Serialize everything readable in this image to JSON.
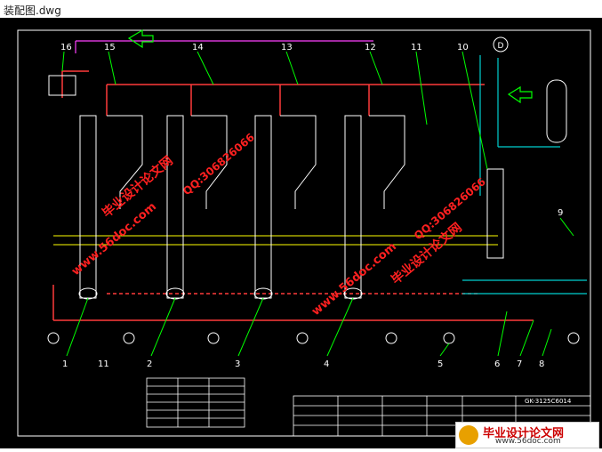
{
  "window": {
    "title": "装配图.dwg"
  },
  "colors": {
    "background": "#000000",
    "border": "#ffffff",
    "steam": "#ff3b3b",
    "water": "#00d0d0",
    "vacuum": "#ffff00",
    "condensate": "#ff40ff",
    "leaders": "#00ff00",
    "watermark": "#ff2020"
  },
  "diagram": {
    "labels_top": [
      "16",
      "15",
      "14",
      "13",
      "12",
      "11",
      "10"
    ],
    "labels_bottom": [
      "1",
      "11",
      "2",
      "3",
      "4",
      "5",
      "6",
      "7",
      "8"
    ],
    "label_right": "9",
    "pump_symbol": "D",
    "legend": {
      "rows": 6
    },
    "title_block": {
      "drawing_no": "GK-3125C6014"
    }
  },
  "watermarks": {
    "site_a": "www.56doc.com",
    "qq_a": "QQ:306826066",
    "brand": "毕业设计论文网"
  },
  "footer_logo": {
    "brand": "毕业设计论文网",
    "url": "www.56doc.com"
  }
}
